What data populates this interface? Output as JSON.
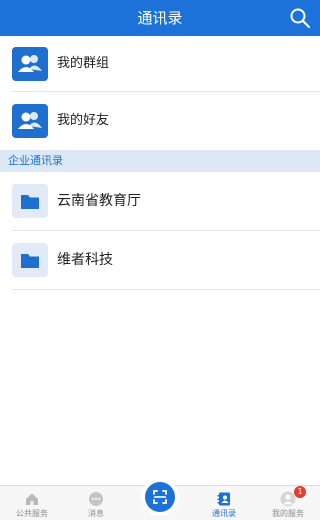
{
  "header": {
    "title": "通讯录",
    "search_icon": "search-icon"
  },
  "groups": [
    {
      "label": "我的群组",
      "icon": "group-contacts-icon"
    },
    {
      "label": "我的好友",
      "icon": "friends-contacts-icon"
    }
  ],
  "section": {
    "label": "企业通讯录"
  },
  "orgs": [
    {
      "label": "云南省教育厅",
      "icon": "folder-icon"
    },
    {
      "label": "维者科技",
      "icon": "folder-icon"
    }
  ],
  "tabbar": {
    "tabs": [
      {
        "label": "公共服务",
        "icon": "home-icon"
      },
      {
        "label": "消息",
        "icon": "chat-icon"
      },
      {
        "label": "",
        "icon": "scan-icon"
      },
      {
        "label": "通讯录",
        "icon": "contacts-icon",
        "active": true
      },
      {
        "label": "我的服务",
        "icon": "user-icon",
        "badge": "1"
      }
    ]
  },
  "colors": {
    "primary": "#1c72d9",
    "section_bg": "#dce8f6",
    "badge": "#e63b2e"
  }
}
